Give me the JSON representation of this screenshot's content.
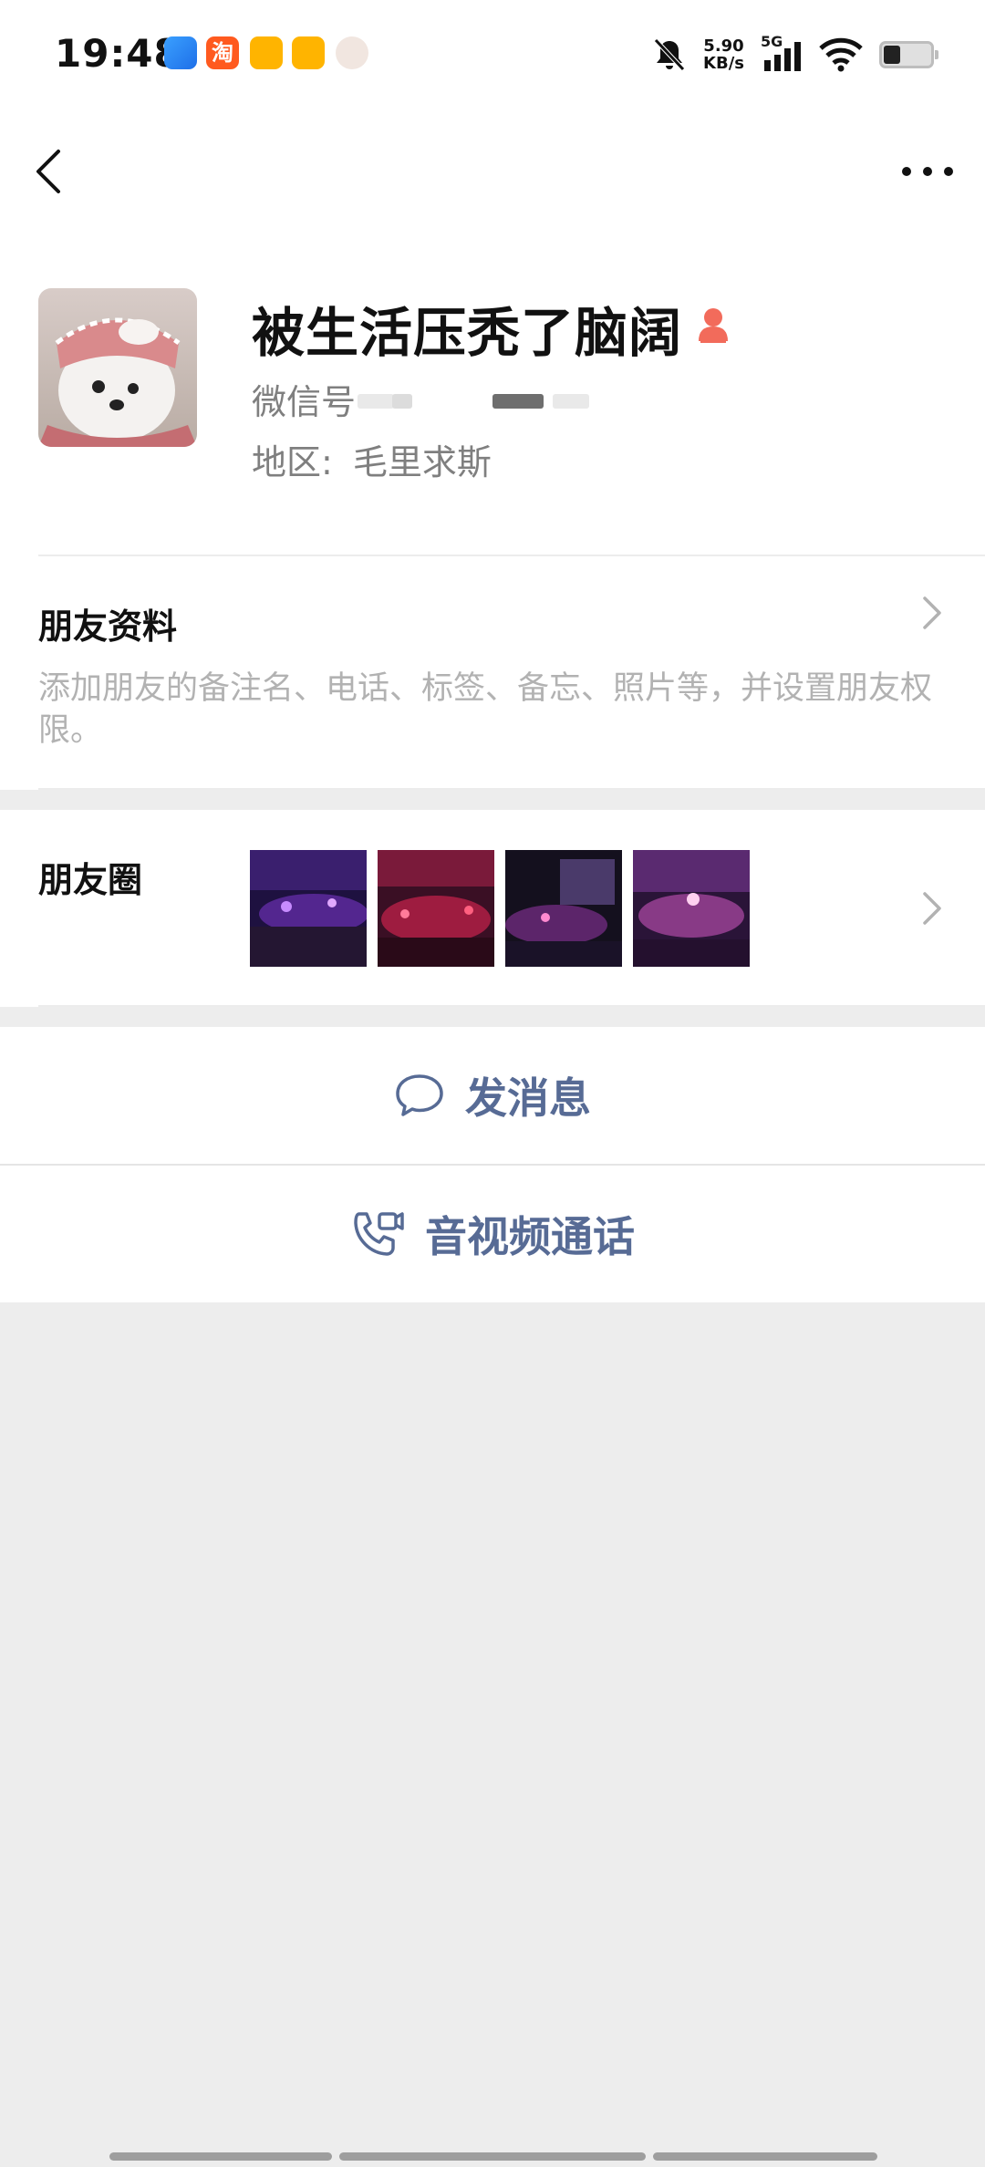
{
  "status_bar": {
    "time": "19:48",
    "net_speed_value": "5.90",
    "net_speed_unit": "KB/s",
    "network_type": "5G",
    "icons": [
      "bell-off-icon",
      "signal-icon",
      "wifi-icon",
      "battery-icon"
    ]
  },
  "nav": {
    "back_icon": "chevron-left-icon",
    "more_icon": "more-dots-icon"
  },
  "profile": {
    "nickname": "被生活压秃了脑阔",
    "wechat_id_label": "微信号",
    "region_label": "地区:",
    "region_value": "毛里求斯"
  },
  "friend_info": {
    "title": "朋友资料",
    "description": "添加朋友的备注名、电话、标签、备忘、照片等，并设置朋友权限。"
  },
  "moments": {
    "title": "朋友圈",
    "thumbnail_count": 4
  },
  "actions": {
    "send_message": "发消息",
    "av_call": "音视频通话"
  },
  "colors": {
    "accent_link": "#576b95",
    "background": "#ededed",
    "gender_female": "#f26b5b"
  }
}
